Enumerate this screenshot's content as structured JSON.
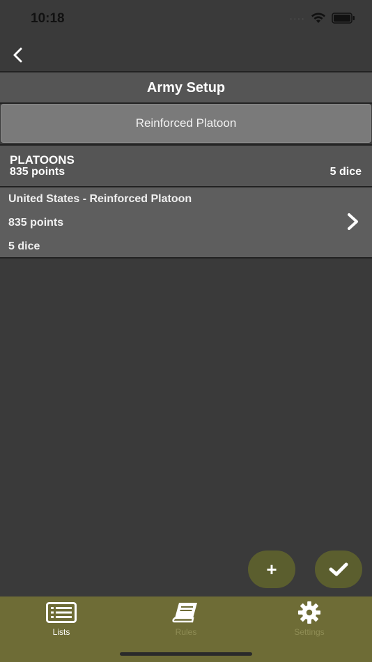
{
  "status_bar": {
    "time": "10:18"
  },
  "header": {
    "title": "Army Setup"
  },
  "army_button": {
    "label": "Reinforced Platoon"
  },
  "section": {
    "title": "PLATOONS",
    "points": "835 points",
    "dice": "5 dice"
  },
  "platoons": [
    {
      "name": "United States - Reinforced Platoon",
      "points": "835 points",
      "dice": "5 dice"
    }
  ],
  "fab": {
    "add_label": "+"
  },
  "tabs": [
    {
      "label": "Lists",
      "icon": "list-icon",
      "active": true
    },
    {
      "label": "Rules",
      "icon": "book-icon",
      "active": false
    },
    {
      "label": "Settings",
      "icon": "gear-icon",
      "active": false
    }
  ],
  "colors": {
    "background": "#3a3a3a",
    "accent": "#6e6c36",
    "fab": "#5b5e2e",
    "row": "#5e5e5e"
  }
}
